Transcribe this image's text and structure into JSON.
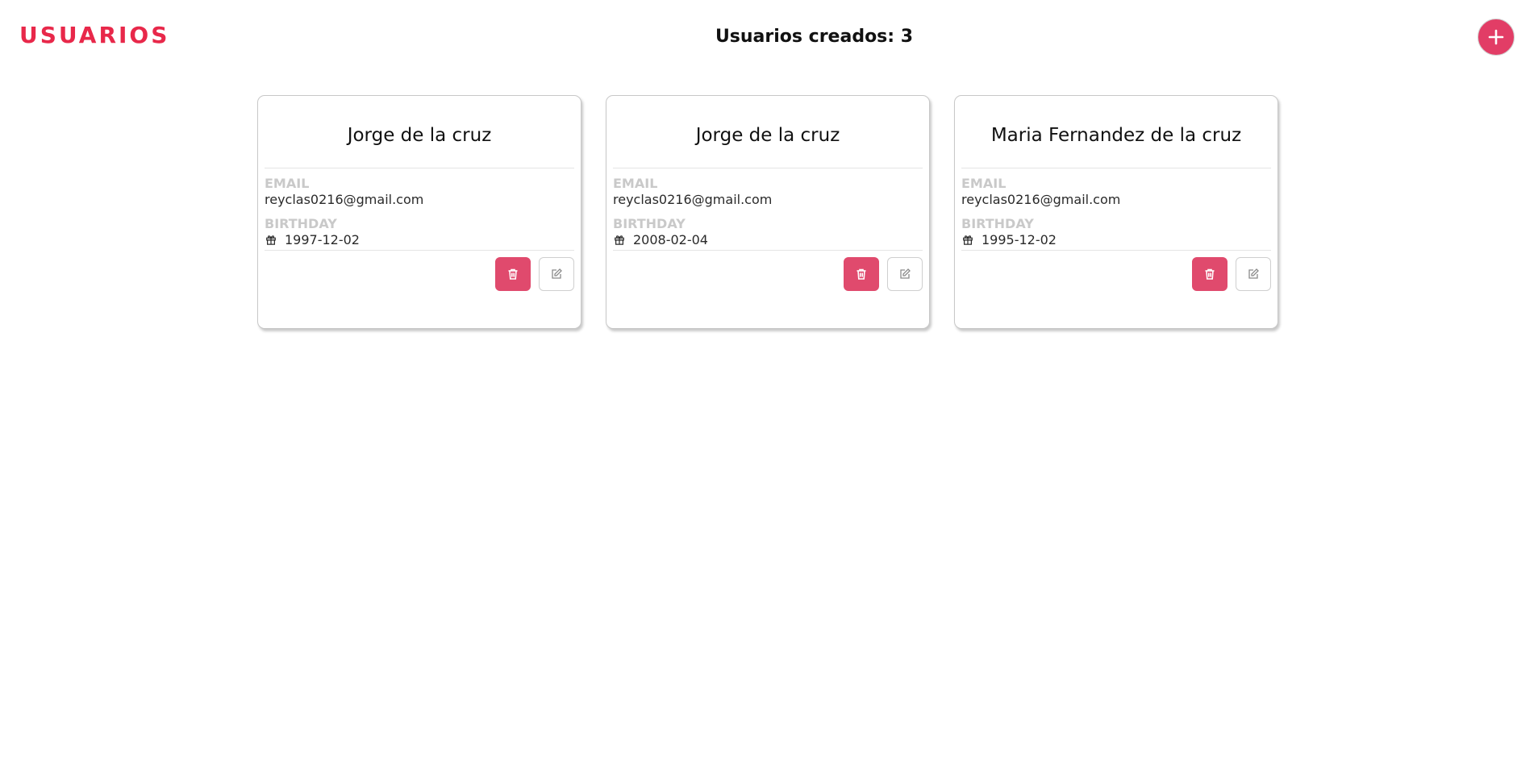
{
  "header": {
    "brand": "USUARIOS",
    "count_label": "Usuarios creados: 3",
    "add_icon": "plus-icon",
    "accent_color": "#e8284a"
  },
  "users": [
    {
      "name": "Jorge de la cruz",
      "email_label": "EMAIL",
      "email": "reyclas0216@gmail.com",
      "birthday_label": "BIRTHDAY",
      "birthday": "1997-12-02"
    },
    {
      "name": "Jorge de la cruz",
      "email_label": "EMAIL",
      "email": "reyclas0216@gmail.com",
      "birthday_label": "BIRTHDAY",
      "birthday": "2008-02-04"
    },
    {
      "name": "Maria Fernandez de la cruz",
      "email_label": "EMAIL",
      "email": "reyclas0216@gmail.com",
      "birthday_label": "BIRTHDAY",
      "birthday": "1995-12-02"
    }
  ],
  "icons": {
    "birthday": "gift-icon",
    "delete": "trash-icon",
    "edit": "edit-icon"
  },
  "colors": {
    "delete_button": "#e04a6d",
    "add_button": "#e23d66",
    "label": "#c9c9c9"
  }
}
